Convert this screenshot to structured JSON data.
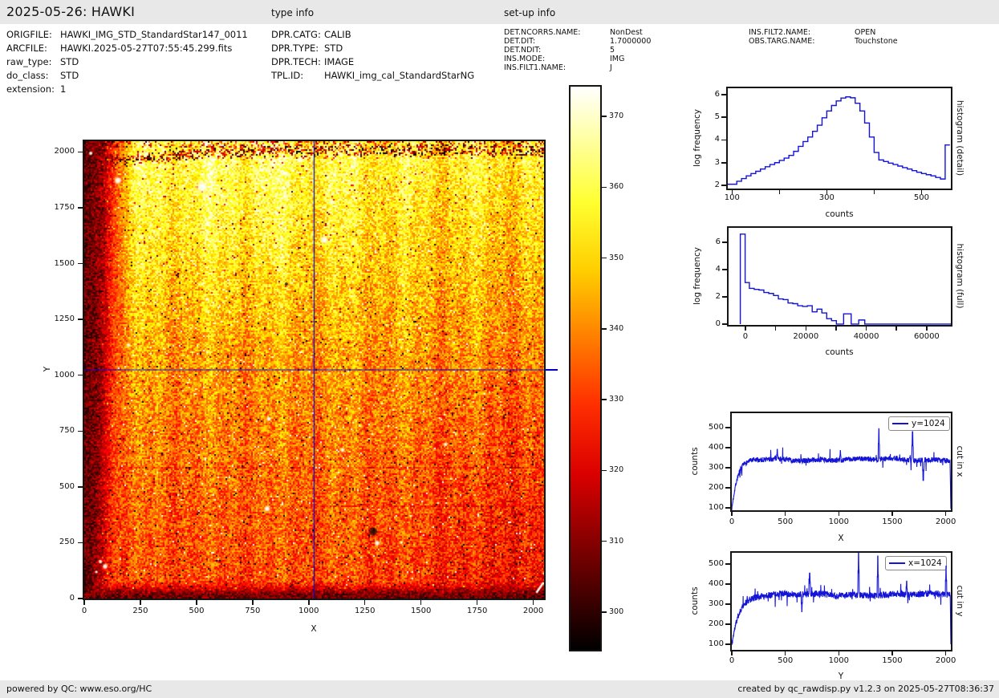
{
  "header": {
    "title": "2025-05-26: HAWKI",
    "type_info_label": "type info",
    "setup_info_label": "set-up info",
    "file_info": [
      {
        "label": "ORIGFILE:",
        "value": "HAWKI_IMG_STD_StandardStar147_0011"
      },
      {
        "label": "ARCFILE:",
        "value": "HAWKI.2025-05-27T07:55:45.299.fits"
      },
      {
        "label": "raw_type:",
        "value": "STD"
      },
      {
        "label": "do_class:",
        "value": "STD"
      },
      {
        "label": "extension:",
        "value": "1"
      }
    ],
    "type_info": [
      {
        "label": "DPR.CATG:",
        "value": "CALIB"
      },
      {
        "label": "DPR.TYPE:",
        "value": "STD"
      },
      {
        "label": "DPR.TECH:",
        "value": "IMAGE"
      },
      {
        "label": "TPL.ID:",
        "value": "HAWKI_img_cal_StandardStarNG"
      }
    ],
    "setup_info_left": [
      {
        "label": "DET.NCORRS.NAME:",
        "value": "NonDest"
      },
      {
        "label": "DET.DIT:",
        "value": "1.7000000"
      },
      {
        "label": "DET.NDIT:",
        "value": "5"
      },
      {
        "label": "INS.MODE:",
        "value": "IMG"
      },
      {
        "label": "INS.FILT1.NAME:",
        "value": "J"
      }
    ],
    "setup_info_right": [
      {
        "label": "INS.FILT2.NAME:",
        "value": "OPEN"
      },
      {
        "label": "OBS.TARG.NAME:",
        "value": "Touchstone"
      }
    ]
  },
  "footer": {
    "left": "powered by QC: www.eso.org/HC",
    "right": "created by qc_rawdisp.py v1.2.3 on 2025-05-27T08:36:37"
  },
  "colors": {
    "line_blue": "#1414d6",
    "crosshair_blue": "#0000cc",
    "bar_gray": "#e8e8e8"
  },
  "chart_data": [
    {
      "id": "detector-image",
      "type": "heatmap",
      "xlabel": "X",
      "ylabel": "Y",
      "xlim": [
        0,
        2048
      ],
      "ylim": [
        0,
        2048
      ],
      "xticks": [
        0,
        250,
        500,
        750,
        1000,
        1250,
        1500,
        1750,
        2000
      ],
      "yticks": [
        0,
        250,
        500,
        750,
        1000,
        1250,
        1500,
        1750,
        2000
      ],
      "colormap": "hot",
      "colorbar": {
        "vmin": 294,
        "vmax": 377,
        "ticks": [
          300,
          310,
          320,
          330,
          340,
          350,
          360,
          370
        ]
      },
      "crosshair": {
        "x": 1024,
        "y": 1024
      },
      "background": {
        "bottom_level": 333,
        "top_level": 363,
        "noise": 13,
        "dark_left_edge_width": 150,
        "dark_bottom_edge_height": 95,
        "dark_top_band_center": 1960
      },
      "stars": [
        [
          29,
          1994,
          1.6
        ],
        [
          150,
          1872,
          3.0
        ],
        [
          526,
          1843,
          5.0
        ],
        [
          958,
          1962,
          2.4
        ],
        [
          1069,
          1606,
          3.4
        ],
        [
          197,
          1135,
          1.6
        ],
        [
          547,
          1340,
          1.6
        ],
        [
          822,
          805,
          2.0
        ],
        [
          1151,
          665,
          1.8
        ],
        [
          815,
          402,
          2.6
        ],
        [
          1305,
          248,
          2.3
        ],
        [
          1413,
          251,
          1.3
        ],
        [
          1609,
          690,
          1.7
        ],
        [
          72,
          165,
          1.6
        ],
        [
          93,
          144,
          2.2
        ],
        [
          54,
          119,
          1.2
        ],
        [
          1850,
          1847,
          1.6
        ]
      ],
      "dark_spots": [
        [
          1287,
          300,
          6
        ],
        [
          900,
          1408,
          2.5
        ]
      ],
      "corner_streak": [
        [
          2014,
          26
        ],
        [
          2046,
          72
        ]
      ]
    },
    {
      "id": "histogram-detail",
      "type": "step",
      "title_right": "histogram (detail)",
      "xlabel": "counts",
      "ylabel": "log frequency",
      "xlim": [
        91,
        562
      ],
      "ylim": [
        1.86,
        6.28
      ],
      "xticks": [
        100,
        200,
        300,
        400,
        500
      ],
      "xtick_labels": [
        100,
        300,
        500
      ],
      "yticks": [
        2,
        3,
        4,
        5,
        6
      ],
      "bin_edges": [
        91,
        110,
        120,
        130,
        140,
        150,
        160,
        170,
        180,
        190,
        200,
        210,
        220,
        230,
        240,
        250,
        260,
        270,
        280,
        290,
        300,
        310,
        320,
        330,
        340,
        350,
        360,
        370,
        380,
        390,
        400,
        410,
        420,
        430,
        440,
        450,
        460,
        470,
        480,
        490,
        500,
        510,
        520,
        530,
        540,
        550,
        560
      ],
      "log_freq": [
        2.05,
        2.18,
        2.3,
        2.42,
        2.52,
        2.62,
        2.72,
        2.82,
        2.92,
        3.0,
        3.1,
        3.2,
        3.32,
        3.5,
        3.72,
        3.93,
        4.13,
        4.38,
        4.65,
        4.98,
        5.28,
        5.52,
        5.72,
        5.85,
        5.9,
        5.86,
        5.62,
        5.28,
        4.75,
        4.13,
        3.45,
        3.12,
        3.05,
        2.98,
        2.92,
        2.85,
        2.78,
        2.72,
        2.65,
        2.58,
        2.52,
        2.47,
        2.42,
        2.35,
        2.28,
        3.78
      ]
    },
    {
      "id": "histogram-full",
      "type": "step",
      "title_right": "histogram (full)",
      "xlabel": "counts",
      "ylabel": "log frequency",
      "xlim": [
        -5577,
        67995
      ],
      "ylim": [
        -0.06,
        7.06
      ],
      "xticks": [
        0,
        10000,
        20000,
        30000,
        40000,
        50000,
        60000
      ],
      "xtick_labels": [
        0,
        20000,
        40000,
        60000
      ],
      "yticks": [
        0,
        2,
        4,
        6
      ],
      "starts_from_zero": true,
      "bin_edges": [
        -1700,
        -100,
        1300,
        2900,
        4500,
        6100,
        7700,
        9300,
        10900,
        12500,
        14100,
        15700,
        17300,
        18900,
        20500,
        22100,
        23700,
        25300,
        26900,
        28500,
        30100,
        32500,
        35000,
        37500,
        39500,
        68000
      ],
      "log_freq": [
        6.6,
        3.05,
        2.62,
        2.55,
        2.5,
        2.32,
        2.25,
        2.1,
        1.85,
        1.8,
        1.55,
        1.5,
        1.35,
        1.3,
        1.35,
        0.9,
        1.1,
        0.82,
        0.4,
        0.25,
        0,
        0.75,
        0,
        0.3,
        0
      ]
    },
    {
      "id": "cut-in-x",
      "type": "line",
      "title_right": "cut in x",
      "legend": "y=1024",
      "xlabel": "X",
      "ylabel": "counts",
      "xlim": [
        0,
        2048
      ],
      "ylim": [
        88,
        572
      ],
      "xticks": [
        0,
        500,
        1000,
        1500,
        2000
      ],
      "yticks": [
        100,
        200,
        300,
        400,
        500
      ],
      "baseline": 341,
      "start": 88,
      "rise_tau": 55,
      "noise": 13,
      "spikes": [
        [
          1375,
          495
        ],
        [
          1690,
          480
        ],
        [
          1790,
          237
        ],
        [
          425,
          392
        ],
        [
          1015,
          386
        ]
      ],
      "end_drop": [
        2040,
        95
      ]
    },
    {
      "id": "cut-in-y",
      "type": "line",
      "title_right": "cut in y",
      "legend": "x=1024",
      "xlabel": "Y",
      "ylabel": "counts",
      "xlim": [
        0,
        2048
      ],
      "ylim": [
        72,
        556
      ],
      "xticks": [
        0,
        500,
        1000,
        1500,
        2000
      ],
      "yticks": [
        100,
        200,
        300,
        400,
        500
      ],
      "baseline": 347,
      "start": 100,
      "rise_tau": 70,
      "noise": 16,
      "spikes": [
        [
          728,
          455
        ],
        [
          1185,
          585
        ],
        [
          1365,
          540
        ],
        [
          1635,
          415
        ],
        [
          655,
          262
        ],
        [
          2003,
          490
        ]
      ],
      "end_drop": [
        2042,
        100
      ]
    }
  ]
}
